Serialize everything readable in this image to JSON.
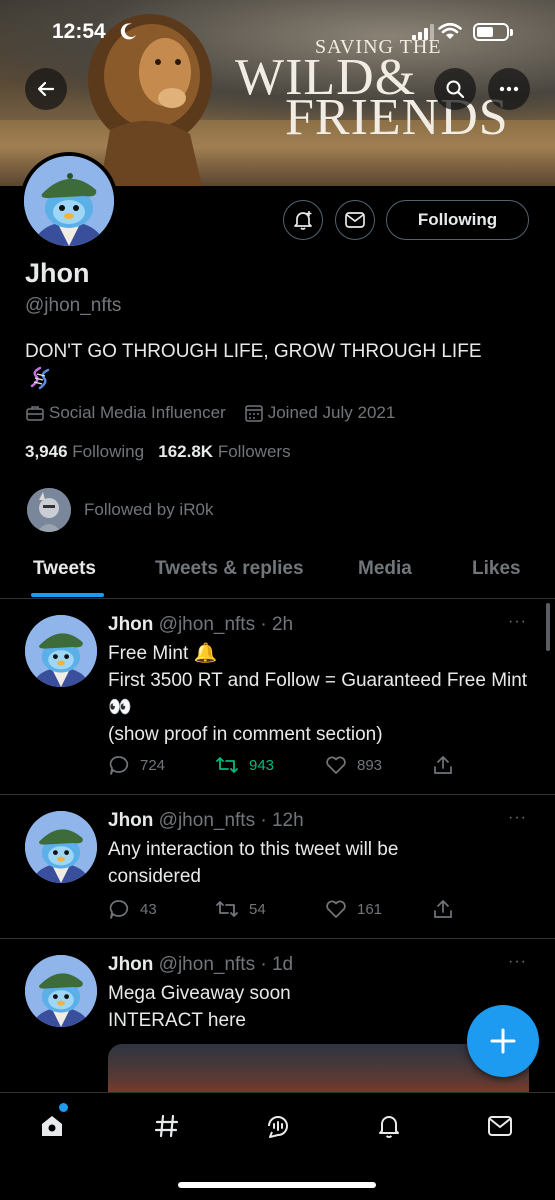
{
  "status_bar": {
    "time": "12:54"
  },
  "banner": {
    "brand_small": "SAVING THE",
    "brand_line1": "WILD&",
    "brand_line2": "FRIENDS"
  },
  "profile": {
    "name": "Jhon",
    "handle": "@jhon_nfts",
    "bio": "DON'T GO THROUGH LIFE, GROW THROUGH LIFE",
    "category": "Social Media Influencer",
    "joined": "Joined July 2021",
    "following_count": "3,946",
    "following_label": "Following",
    "followers_count": "162.8K",
    "followers_label": "Followers",
    "followed_by": "Followed by iR0k",
    "follow_button": "Following"
  },
  "tabs": [
    {
      "label": "Tweets",
      "active": true
    },
    {
      "label": "Tweets & replies",
      "active": false
    },
    {
      "label": "Media",
      "active": false
    },
    {
      "label": "Likes",
      "active": false
    }
  ],
  "tweets": [
    {
      "name": "Jhon",
      "meta": "@jhon_nfts · 2h",
      "lines": [
        "Free Mint 🔔",
        "First 3500 RT and Follow  = Guaranteed Free Mint 👀",
        "(show proof in comment section)"
      ],
      "replies": "724",
      "retweets": "943",
      "likes": "893"
    },
    {
      "name": "Jhon",
      "meta": "@jhon_nfts · 12h",
      "lines": [
        "Any interaction to this tweet will be considered"
      ],
      "replies": "43",
      "retweets": "54",
      "likes": "161"
    },
    {
      "name": "Jhon",
      "meta": "@jhon_nfts · 1d",
      "lines": [
        "Mega Giveaway soon",
        "INTERACT here"
      ]
    }
  ],
  "more_dots": "···",
  "colors": {
    "accent": "#1d9bf0",
    "retweet_active": "#00ba7c",
    "muted": "#71767b",
    "text": "#e7e9ea",
    "background": "#000000"
  },
  "icons": {
    "back": "arrow-left-icon",
    "search": "search-icon",
    "more": "more-horizontal-icon",
    "notify": "bell-plus-icon",
    "message": "envelope-icon",
    "category": "briefcase-icon",
    "calendar": "calendar-icon",
    "compose": "plus-icon",
    "nav": [
      "home-icon",
      "hashtag-icon",
      "spaces-icon",
      "bell-icon",
      "envelope-icon"
    ]
  }
}
